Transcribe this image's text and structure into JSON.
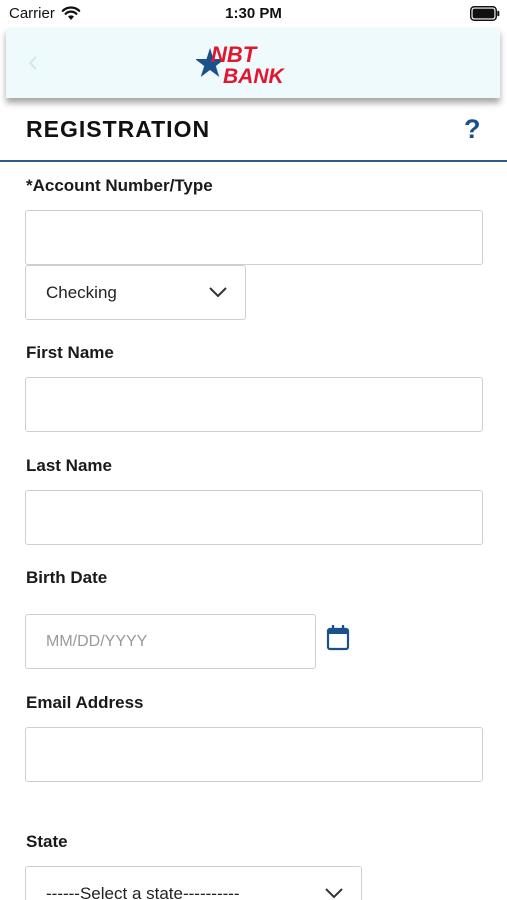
{
  "status_bar": {
    "carrier": "Carrier",
    "time": "1:30 PM"
  },
  "header": {
    "logo_top": "NBT",
    "logo_bottom": "BANK",
    "brand_color": "#e2162e",
    "accent_color": "#1b5189"
  },
  "page": {
    "title": "REGISTRATION",
    "help": "?"
  },
  "form": {
    "account": {
      "label": "*Account Number/Type",
      "value": "",
      "type_value": "Checking"
    },
    "first_name": {
      "label": "First Name",
      "value": ""
    },
    "last_name": {
      "label": "Last Name",
      "value": ""
    },
    "birth_date": {
      "label": "Birth Date",
      "placeholder": "MM/DD/YYYY"
    },
    "email": {
      "label": "Email Address",
      "value": ""
    },
    "state": {
      "label": "State",
      "value": "------Select a state----------"
    }
  }
}
